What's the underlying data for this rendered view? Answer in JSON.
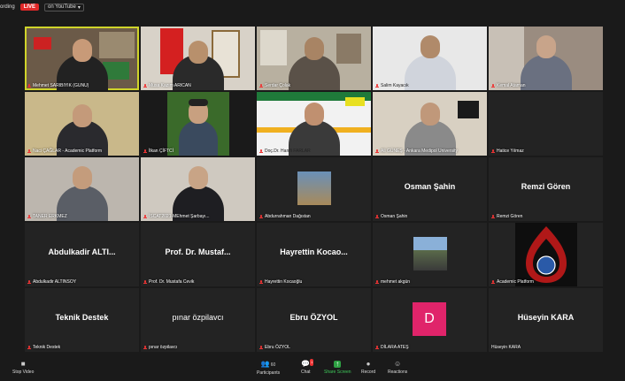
{
  "topbar": {
    "recording_text": "ording",
    "live_badge": "LIVE",
    "youtube_label": "on YouTube"
  },
  "tiles": [
    {
      "name": "Mehmet SARIBIYIK (GUNU)",
      "type": "video",
      "active": true
    },
    {
      "name": "Musa Kazım ARICAN",
      "type": "video"
    },
    {
      "name": "Serdar Çolak",
      "type": "video"
    },
    {
      "name": "Salim Kayacık",
      "type": "video"
    },
    {
      "name": "Kemal Ataman",
      "type": "video"
    },
    {
      "name": "Naci ÇAĞLAR - Academic Platform",
      "type": "video"
    },
    {
      "name": "İlkan ÇİFTCİ",
      "type": "video"
    },
    {
      "name": "Doç.Dr. Hanifi FARLAR",
      "type": "video"
    },
    {
      "name": "Ali GÜNEŞ - Ankara Medipol University",
      "type": "video"
    },
    {
      "name": "Hatice Yılmaz",
      "type": "video"
    },
    {
      "name": "TANER ERKMEZ",
      "type": "video"
    },
    {
      "name": "İSCAT2021-MEhmet Şarbayı...",
      "type": "video"
    },
    {
      "name": "Abdurrahman Dağıstan",
      "type": "photo"
    },
    {
      "name": "Osman Şahin",
      "type": "text",
      "display": "Osman Şahin"
    },
    {
      "name": "Remzi Gören",
      "type": "text",
      "display": "Remzi Gören"
    },
    {
      "name": "Abdulkadir ALTINSOY",
      "type": "text",
      "display": "Abdulkadir ALTI..."
    },
    {
      "name": "Prof. Dr. Mustafa Cevik",
      "type": "text",
      "display": "Prof. Dr. Mustaf..."
    },
    {
      "name": "Hayrettin Kocaoğlu",
      "type": "text",
      "display": "Hayrettin Kocao..."
    },
    {
      "name": "mehmet akgün",
      "type": "photo"
    },
    {
      "name": "Academic Platform",
      "type": "logo"
    },
    {
      "name": "Teknik Destek",
      "type": "text",
      "display": "Teknik Destek"
    },
    {
      "name": "pınar özpilavcı",
      "type": "text",
      "display": "pınar özpilavcı"
    },
    {
      "name": "Ebru ÖZYOL",
      "type": "text",
      "display": "Ebru ÖZYOL"
    },
    {
      "name": "DİLARA ATEŞ",
      "type": "avatar",
      "display": "D",
      "avatar_color": "#e0246a"
    },
    {
      "name": "Hüseyin KARA",
      "type": "text",
      "display": "Hüseyin KARA"
    }
  ],
  "toolbar": {
    "stop_video": "Stop Video",
    "participants": "Participants",
    "participants_count": "60",
    "chat": "Chat",
    "chat_badge": "1",
    "share_screen": "Share Screen",
    "record": "Record",
    "reactions": "Reactions"
  },
  "colors": {
    "active_border": "#cfd42a",
    "share_green": "#2ea043",
    "muted_red": "#e33333"
  }
}
